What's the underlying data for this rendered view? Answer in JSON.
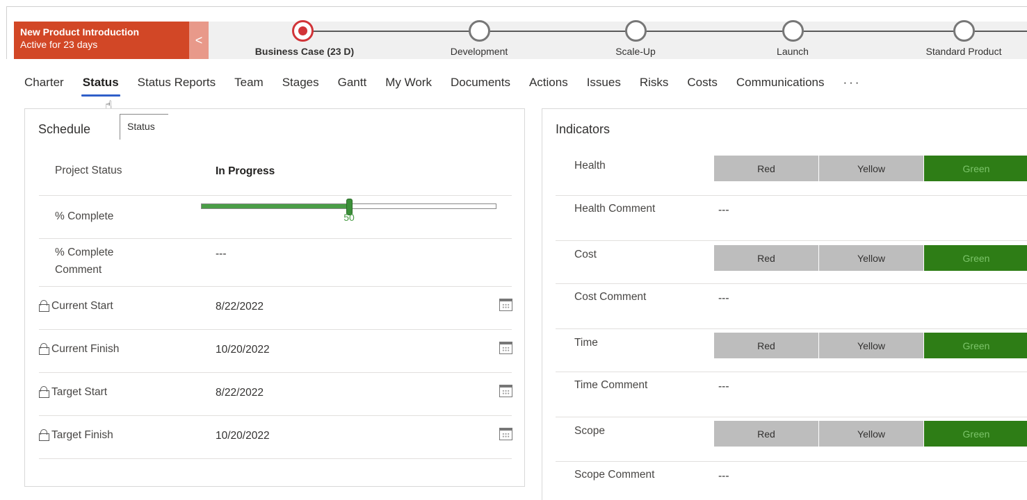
{
  "process": {
    "name": "New Product Introduction",
    "active_for": "Active for 23 days",
    "collapse_glyph": "<",
    "stages": [
      {
        "label": "Business Case  (23 D)",
        "active": true
      },
      {
        "label": "Development",
        "active": false
      },
      {
        "label": "Scale-Up",
        "active": false
      },
      {
        "label": "Launch",
        "active": false
      },
      {
        "label": "Standard Product",
        "active": false
      }
    ]
  },
  "tabs": [
    "Charter",
    "Status",
    "Status Reports",
    "Team",
    "Stages",
    "Gantt",
    "My Work",
    "Documents",
    "Actions",
    "Issues",
    "Risks",
    "Costs",
    "Communications",
    "···"
  ],
  "selected_tab": "Status",
  "schedule": {
    "title": "Schedule",
    "tooltip": "Status",
    "project_status_label": "Project Status",
    "project_status_value": "In Progress",
    "percent_complete_label": "% Complete",
    "percent_complete_value": 50,
    "percent_complete_display": "50",
    "percent_comment_label_1": "% Complete",
    "percent_comment_label_2": "Comment",
    "percent_comment_value": "---",
    "dates": [
      {
        "label": "Current Start",
        "value": "8/22/2022"
      },
      {
        "label": "Current Finish",
        "value": "10/20/2022"
      },
      {
        "label": "Target Start",
        "value": "8/22/2022"
      },
      {
        "label": "Target Finish",
        "value": "10/20/2022"
      }
    ]
  },
  "indicators": {
    "title": "Indicators",
    "options": [
      "Red",
      "Yellow",
      "Green"
    ],
    "colors": {
      "selected": "#2e7d16",
      "unselected": "#bdbdbd",
      "accent": "#d24726",
      "tab_underline": "#2f5fc9"
    },
    "items": [
      {
        "label": "Health",
        "selected": "Green",
        "comment_label": "Health Comment",
        "comment": "---"
      },
      {
        "label": "Cost",
        "selected": "Green",
        "comment_label": "Cost Comment",
        "comment": "---"
      },
      {
        "label": "Time",
        "selected": "Green",
        "comment_label": "Time Comment",
        "comment": "---"
      },
      {
        "label": "Scope",
        "selected": "Green",
        "comment_label": "Scope Comment",
        "comment": "---"
      }
    ]
  }
}
